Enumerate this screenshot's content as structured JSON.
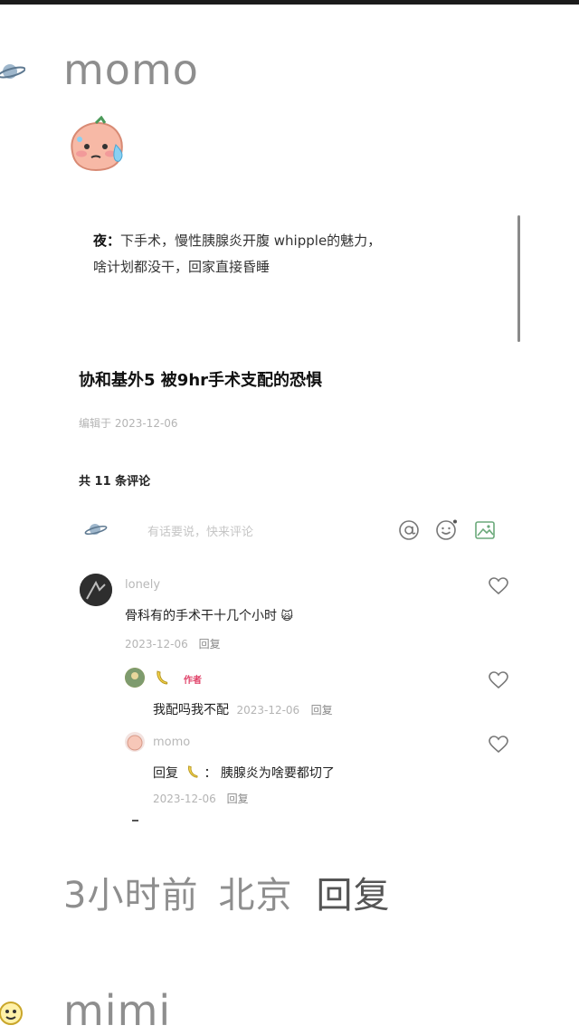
{
  "comment1": {
    "username": "momo"
  },
  "post": {
    "note_label": "夜：",
    "note_text": "下手术，慢性胰腺炎开腹 whipple的魅力，",
    "note_text2": "啥计划都没干，回家直接昏睡",
    "title": "协和基外5 被9hr手术支配的恐惧",
    "edited": "编辑于 2023-12-06",
    "comment_count": "共 11 条评论",
    "input_placeholder": "有话要说，快来评论",
    "icons": [
      "at-icon",
      "emoji-icon",
      "image-icon"
    ]
  },
  "thread": [
    {
      "name": "lonely",
      "text": "骨科有的手术干十几个小时",
      "date": "2023-12-06",
      "reply": "回复"
    },
    {
      "badge": "作者",
      "text": "我配吗我不配",
      "date": "2023-12-06",
      "reply": "回复"
    },
    {
      "name": "momo",
      "prefix": "回复",
      "text": "胰腺炎为啥要都切了",
      "date": "2023-12-06",
      "reply": "回复"
    }
  ],
  "footer": {
    "time": "3小时前",
    "location": "北京",
    "reply": "回复"
  },
  "comment2": {
    "username": "mimi"
  },
  "colors": {
    "accent_red": "#e0446a",
    "muted_gray": "#8e8e8e"
  }
}
